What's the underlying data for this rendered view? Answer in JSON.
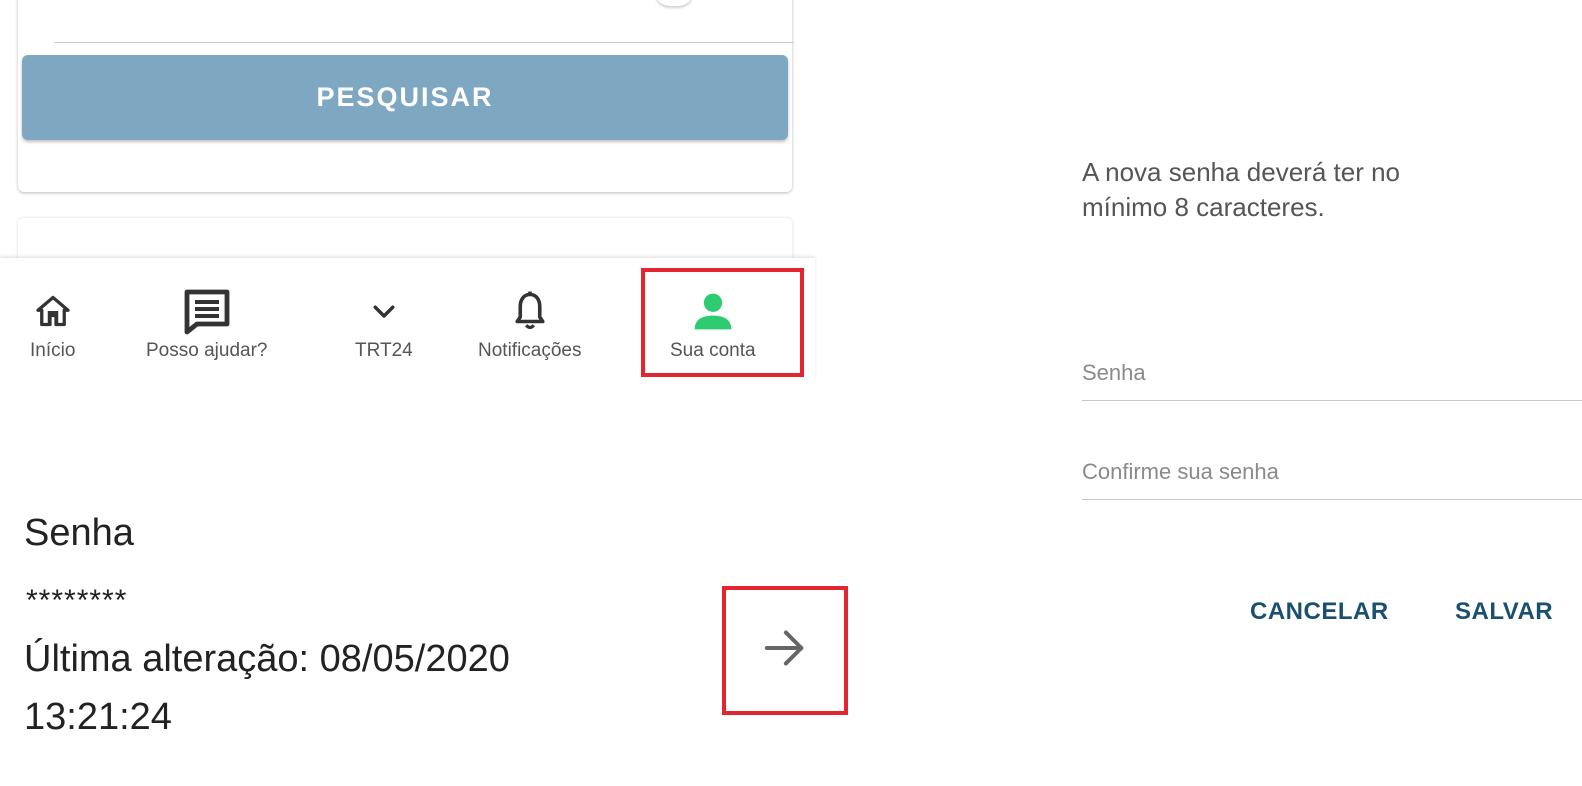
{
  "search": {
    "button_label": "PESQUISAR"
  },
  "nav": {
    "items": [
      {
        "label": "Início",
        "icon": "home-icon"
      },
      {
        "label": "Posso ajudar?",
        "icon": "chat-icon"
      },
      {
        "label": "TRT24",
        "icon": "chevron-down-icon"
      },
      {
        "label": "Notificações",
        "icon": "bell-icon"
      },
      {
        "label": "Sua conta",
        "icon": "person-icon",
        "active": true
      }
    ],
    "active_color": "#2ecc71"
  },
  "password_section": {
    "title": "Senha",
    "masked_value": "********",
    "last_changed_line1": "Última alteração: 08/05/2020",
    "last_changed_line2": "13:21:24",
    "arrow_icon": "arrow-right-icon"
  },
  "dialog": {
    "message_line1": "A nova senha deverá ter no",
    "message_line2": "mínimo 8 caracteres.",
    "password_placeholder": "Senha",
    "confirm_placeholder": "Confirme sua senha",
    "cancel_label": "CANCELAR",
    "save_label": "SALVAR"
  },
  "colors": {
    "search_button": "#7ea8c2",
    "highlight": "#e3262d",
    "dialog_action": "#1b4f72"
  }
}
